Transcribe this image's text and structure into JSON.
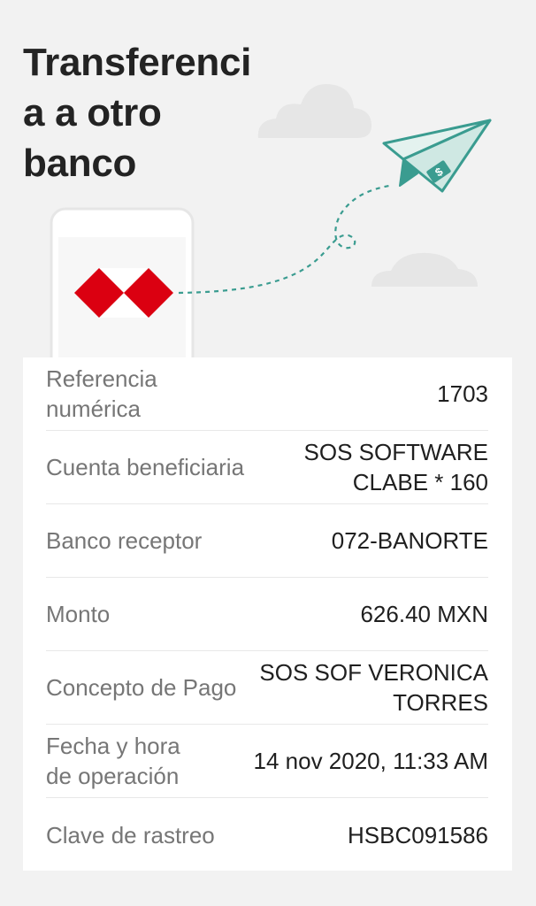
{
  "page": {
    "title_lines": [
      "Transferenci",
      "a a otro",
      "banco"
    ]
  },
  "details": {
    "rows": [
      {
        "label_lines": [
          "Referencia",
          "numérica"
        ],
        "value_lines": [
          "1703"
        ]
      },
      {
        "label_lines": [
          "Cuenta beneficiaria"
        ],
        "value_lines": [
          "SOS SOFTWARE",
          "CLABE * 160"
        ]
      },
      {
        "label_lines": [
          "Banco receptor"
        ],
        "value_lines": [
          "072-BANORTE"
        ]
      },
      {
        "label_lines": [
          "Monto"
        ],
        "value_lines": [
          "626.40 MXN"
        ]
      },
      {
        "label_lines": [
          "Concepto de Pago"
        ],
        "value_lines": [
          "SOS SOF VERONICA",
          "TORRES"
        ]
      },
      {
        "label_lines": [
          "Fecha y hora",
          "de operación"
        ],
        "value_lines": [
          "14 nov 2020, 11:33 AM"
        ]
      },
      {
        "label_lines": [
          "Clave de rastreo"
        ],
        "value_lines": [
          "HSBC091586"
        ]
      }
    ]
  },
  "colors": {
    "background": "#f2f2f2",
    "hsbc_red": "#db0011",
    "plane_teal": "#3a9c90",
    "plane_fill": "#cfe8e3",
    "cloud": "#e6e6e6"
  },
  "icons": {
    "logo": "hsbc-hexagon-logo",
    "plane": "paper-plane-icon",
    "currency": "dollar-icon"
  }
}
